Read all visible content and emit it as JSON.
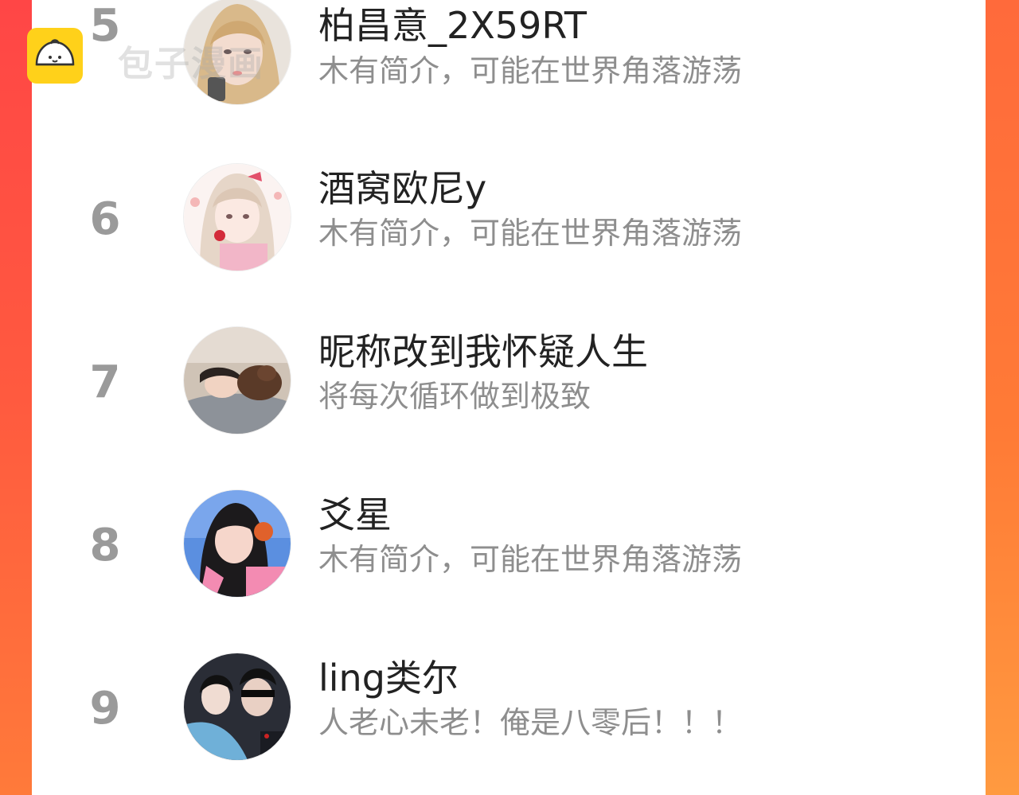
{
  "watermark": {
    "text": "包子漫画",
    "logo_icon": "bun-logo-icon"
  },
  "colors": {
    "frame_left": "#ff4646",
    "frame_right": "#ff7b36",
    "rank_text": "#9a9a9a",
    "name_text": "#222222",
    "bio_text": "#8e8e8e"
  },
  "list": {
    "rows": [
      {
        "rank": "5",
        "name": "柏昌意_2X59RT",
        "bio": "木有简介，可能在世界角落游荡"
      },
      {
        "rank": "6",
        "name": "酒窝欧尼y",
        "bio": "木有简介，可能在世界角落游荡"
      },
      {
        "rank": "7",
        "name": "昵称改到我怀疑人生",
        "bio": "将每次循环做到极致"
      },
      {
        "rank": "8",
        "name": "爻星",
        "bio": "木有简介，可能在世界角落游荡"
      },
      {
        "rank": "9",
        "name": "ling类尔",
        "bio": "人老心未老！俺是八零后！！！"
      }
    ]
  }
}
